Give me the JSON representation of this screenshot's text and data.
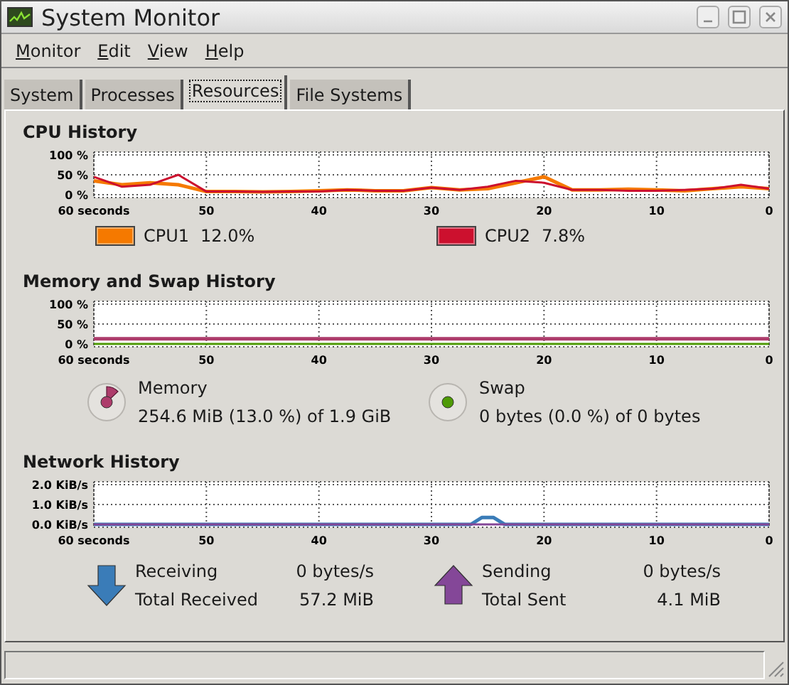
{
  "window": {
    "title": "System Monitor"
  },
  "menu": [
    {
      "label": "Monitor"
    },
    {
      "label": "Edit"
    },
    {
      "label": "View"
    },
    {
      "label": "Help"
    }
  ],
  "tabs": [
    {
      "label": "System",
      "selected": false
    },
    {
      "label": "Processes",
      "selected": false
    },
    {
      "label": "Resources",
      "selected": true
    },
    {
      "label": "File Systems",
      "selected": false
    }
  ],
  "cpu": {
    "title": "CPU History",
    "chart_data": {
      "type": "line",
      "grid": true,
      "xlim": [
        60,
        0
      ],
      "ylim": [
        0,
        100
      ],
      "xticks": [
        {
          "value": 60,
          "label": "60 seconds"
        },
        50,
        40,
        30,
        20,
        10,
        0
      ],
      "yticks": [
        {
          "value": 0,
          "label": "0 %"
        },
        {
          "value": 50,
          "label": "50 %"
        },
        {
          "value": 100,
          "label": "100 %"
        }
      ],
      "x": [
        60,
        57.5,
        55,
        52.5,
        50,
        47.5,
        45,
        42.5,
        40,
        37.5,
        35,
        32.5,
        30,
        27.5,
        25,
        22.5,
        20,
        17.5,
        15,
        12.5,
        10,
        7.5,
        5,
        2.5,
        0
      ],
      "series": [
        {
          "name": "CPU1",
          "color": "#f57900",
          "values": [
            35,
            25,
            30,
            25,
            8,
            8,
            7,
            8,
            10,
            12,
            10,
            10,
            18,
            12,
            15,
            30,
            45,
            12,
            12,
            14,
            12,
            10,
            15,
            20,
            15
          ]
        },
        {
          "name": "CPU2",
          "color": "#cc102e",
          "values": [
            45,
            20,
            25,
            50,
            8,
            8,
            7,
            8,
            8,
            12,
            10,
            10,
            18,
            12,
            20,
            35,
            30,
            12,
            12,
            10,
            10,
            12,
            15,
            25,
            15
          ]
        }
      ]
    },
    "legend": [
      {
        "value": "12.0%"
      },
      {
        "value": "7.8%"
      }
    ]
  },
  "memory": {
    "title": "Memory and Swap History",
    "chart_data": {
      "type": "line",
      "grid": true,
      "xlim": [
        60,
        0
      ],
      "ylim": [
        0,
        100
      ],
      "xticks": [
        {
          "value": 60,
          "label": "60 seconds"
        },
        50,
        40,
        30,
        20,
        10,
        0
      ],
      "yticks": [
        {
          "value": 0,
          "label": "0 %"
        },
        {
          "value": 50,
          "label": "50 %"
        },
        {
          "value": 100,
          "label": "100 %"
        }
      ],
      "x": [
        60,
        0
      ],
      "series": [
        {
          "name": "Memory",
          "color": "#ad3c6b",
          "values": [
            13,
            13
          ]
        },
        {
          "name": "Swap",
          "color": "#4e9a06",
          "values": [
            0,
            0
          ]
        }
      ]
    },
    "legend": [
      {
        "detail": "254.6 MiB (13.0 %) of 1.9 GiB"
      },
      {
        "detail": "0 bytes (0.0 %) of 0 bytes"
      }
    ]
  },
  "network": {
    "title": "Network History",
    "chart_data": {
      "type": "line",
      "grid": true,
      "xlim": [
        60,
        0
      ],
      "ylim": [
        0,
        2
      ],
      "xticks": [
        {
          "value": 60,
          "label": "60 seconds"
        },
        50,
        40,
        30,
        20,
        10,
        0
      ],
      "yticks": [
        {
          "value": 0,
          "label": "0.0 KiB/s"
        },
        {
          "value": 1,
          "label": "1.0 KiB/s"
        },
        {
          "value": 2,
          "label": "2.0 KiB/s"
        }
      ],
      "x": [
        60,
        26.5,
        25.5,
        24.5,
        23.5,
        0
      ],
      "series": [
        {
          "name": "Receiving",
          "color": "#3a7cb8",
          "values": [
            0,
            0,
            0.35,
            0.35,
            0,
            0
          ]
        },
        {
          "name": "Sending",
          "color": "#844798",
          "values": [
            0,
            0,
            0,
            0,
            0,
            0
          ]
        }
      ]
    },
    "stats": [
      {
        "kind": "receiving",
        "value": "0 bytes/s",
        "total_label": "Total Received",
        "total": "57.2 MiB"
      },
      {
        "kind": "sending",
        "value": "0 bytes/s",
        "total_label": "Total Sent",
        "total": "4.1 MiB"
      }
    ]
  }
}
